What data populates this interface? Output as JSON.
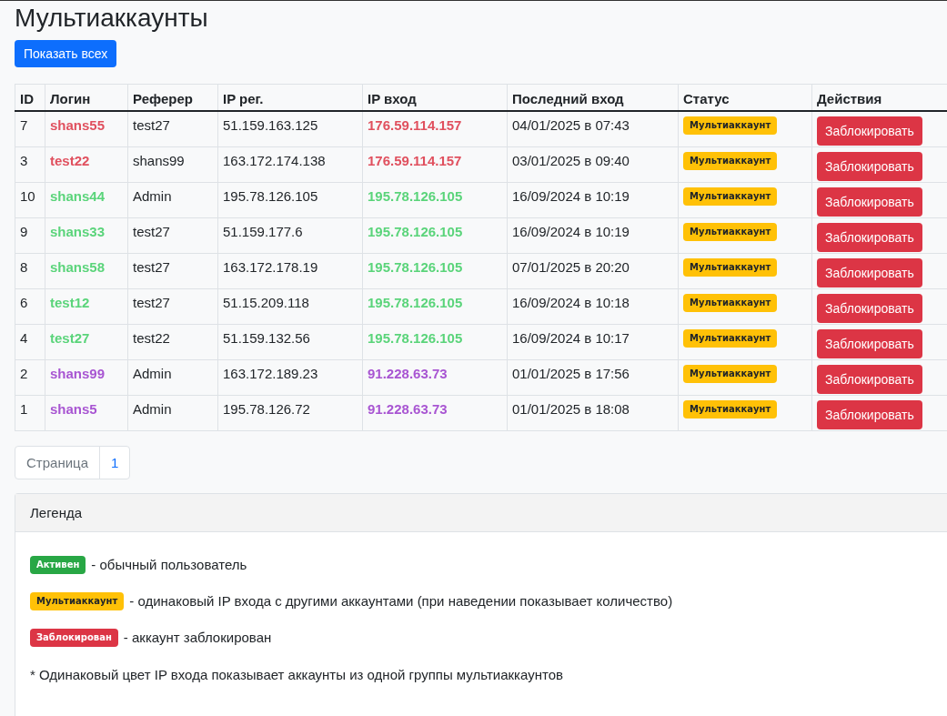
{
  "title": "Мультиаккаунты",
  "show_all_button": "Показать всех",
  "table": {
    "columns": [
      "ID",
      "Логин",
      "Реферер",
      "IP рег.",
      "IP вход",
      "Последний вход",
      "Статус",
      "Действия"
    ],
    "rows": [
      {
        "id": "7",
        "login": "shans55",
        "referrer": "test27",
        "ip_reg": "51.159.163.125",
        "ip_login": "176.59.114.157",
        "last_login": "04/01/2025 в 07:43",
        "status": {
          "kind": "warning",
          "label": "Мультиаккаунт"
        },
        "action": "Заблокировать",
        "color": "#e0505e"
      },
      {
        "id": "3",
        "login": "test22",
        "referrer": "shans99",
        "ip_reg": "163.172.174.138",
        "ip_login": "176.59.114.157",
        "last_login": "03/01/2025 в 09:40",
        "status": {
          "kind": "warning",
          "label": "Мультиаккаунт"
        },
        "action": "Заблокировать",
        "color": "#e0505e"
      },
      {
        "id": "10",
        "login": "shans44",
        "referrer": "Admin",
        "ip_reg": "195.78.126.105",
        "ip_login": "195.78.126.105",
        "last_login": "16/09/2024 в 10:19",
        "status": {
          "kind": "warning",
          "label": "Мультиаккаунт"
        },
        "action": "Заблокировать",
        "color": "#5ad47a"
      },
      {
        "id": "9",
        "login": "shans33",
        "referrer": "test27",
        "ip_reg": "51.159.177.6",
        "ip_login": "195.78.126.105",
        "last_login": "16/09/2024 в 10:19",
        "status": {
          "kind": "warning",
          "label": "Мультиаккаунт"
        },
        "action": "Заблокировать",
        "color": "#5ad47a"
      },
      {
        "id": "8",
        "login": "shans58",
        "referrer": "test27",
        "ip_reg": "163.172.178.19",
        "ip_login": "195.78.126.105",
        "last_login": "07/01/2025 в 20:20",
        "status": {
          "kind": "warning",
          "label": "Мультиаккаунт"
        },
        "action": "Заблокировать",
        "color": "#5ad47a"
      },
      {
        "id": "6",
        "login": "test12",
        "referrer": "test27",
        "ip_reg": "51.15.209.118",
        "ip_login": "195.78.126.105",
        "last_login": "16/09/2024 в 10:18",
        "status": {
          "kind": "warning",
          "label": "Мультиаккаунт"
        },
        "action": "Заблокировать",
        "color": "#5ad47a"
      },
      {
        "id": "4",
        "login": "test27",
        "referrer": "test22",
        "ip_reg": "51.159.132.56",
        "ip_login": "195.78.126.105",
        "last_login": "16/09/2024 в 10:17",
        "status": {
          "kind": "warning",
          "label": "Мультиаккаунт"
        },
        "action": "Заблокировать",
        "color": "#5ad47a"
      },
      {
        "id": "2",
        "login": "shans99",
        "referrer": "Admin",
        "ip_reg": "163.172.189.23",
        "ip_login": "91.228.63.73",
        "last_login": "01/01/2025 в 17:56",
        "status": {
          "kind": "warning",
          "label": "Мультиаккаунт"
        },
        "action": "Заблокировать",
        "color": "#a855d2"
      },
      {
        "id": "1",
        "login": "shans5",
        "referrer": "Admin",
        "ip_reg": "195.78.126.72",
        "ip_login": "91.228.63.73",
        "last_login": "01/01/2025 в 18:08",
        "status": {
          "kind": "warning",
          "label": "Мультиаккаунт"
        },
        "action": "Заблокировать",
        "color": "#a855d2"
      }
    ]
  },
  "pagination": {
    "label": "Страница",
    "pages": [
      {
        "label": "1",
        "selected": true
      }
    ]
  },
  "legend": {
    "title": "Легенда",
    "items": [
      {
        "kind": "success",
        "badge": "Активен",
        "text": "- обычный пользователь"
      },
      {
        "kind": "warning",
        "badge": "Мультиаккаунт",
        "text": "- одинаковый IP входа с другими аккаунтами (при наведении показывает количество)"
      },
      {
        "kind": "danger",
        "badge": "Заблокирован",
        "text": "- аккаунт заблокирован"
      }
    ],
    "note": "* Одинаковый цвет IP входа показывает аккаунты из одной группы мультиаккаунтов"
  }
}
